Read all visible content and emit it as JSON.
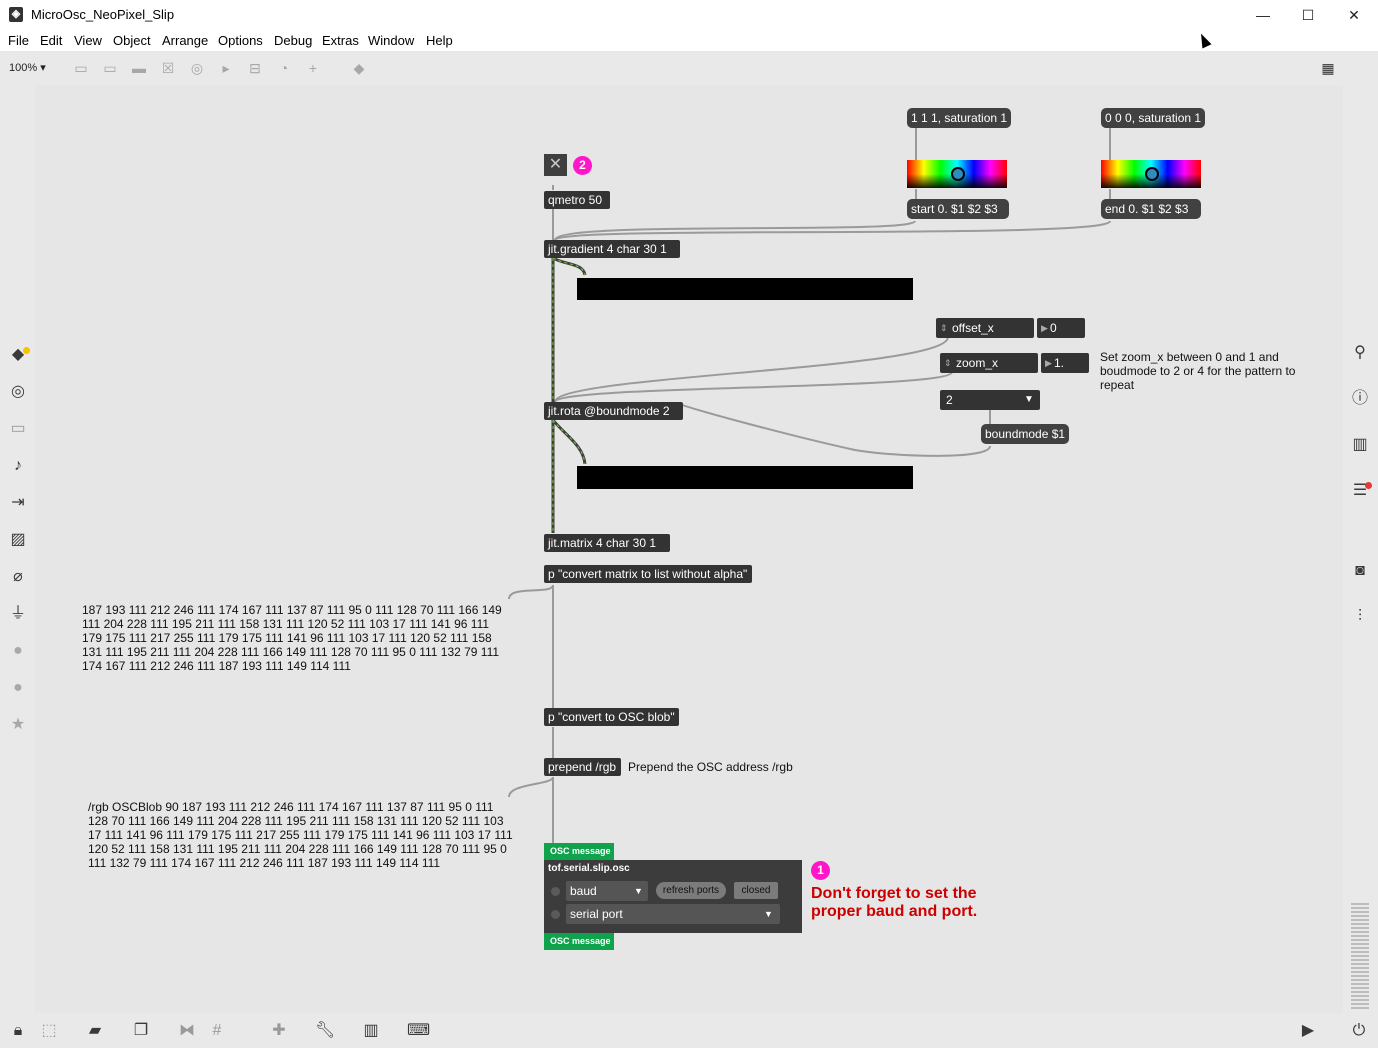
{
  "window": {
    "title": "MicroOsc_NeoPixel_Slip",
    "minimize": "—",
    "maximize": "☐",
    "close": "✕"
  },
  "menu": [
    "File",
    "Edit",
    "View",
    "Object",
    "Arrange",
    "Options",
    "Debug",
    "Extras",
    "Window",
    "Help"
  ],
  "toolbar": {
    "zoom": "100%",
    "zoom_arrow": "▾"
  },
  "patch": {
    "toggle_glyph": "✕",
    "badge_2": "2",
    "badge_1": "1",
    "qmetro": "qmetro 50",
    "msg_start_color": "1 1 1, saturation 1",
    "msg_end_color": "0 0 0, saturation 1",
    "msg_start": "start 0. $1 $2 $3",
    "msg_end": "end 0. $1 $2 $3",
    "jit_gradient": "jit.gradient 4 char 30 1",
    "offset_x_label": "offset_x",
    "offset_x_value": "0",
    "zoom_x_label": "zoom_x",
    "zoom_x_value": "1.",
    "zoom_comment": "Set zoom_x between 0 and 1 and\nboudmode to 2 or 4 for the pattern to\nrepeat",
    "boundmode_menu": "2",
    "boundmode_msg": "boundmode $1",
    "jit_rota": "jit.rota @boundmode 2",
    "jit_matrix": "jit.matrix 4 char 30 1",
    "p_convert_list": "p \"convert matrix to list without alpha\"",
    "list_output": "187 193 111 212 246 111 174 167 111 137 87 111 95 0 111 128 70 111 166 149\n111 204 228 111 195 211 111 158 131 111 120 52 111 103 17 111 141 96 111\n179 175 111 217 255 111 179 175 111 141 96 111 103 17 111 120 52 111 158\n131 111 195 211 111 204 228 111 166 149 111 128 70 111 95 0 111 132 79 111\n174 167 111 212 246 111 187 193 111 149 114 111",
    "p_convert_osc": "p \"convert to OSC blob\"",
    "prepend": "prepend /rgb",
    "prepend_comment": "Prepend the OSC address /rgb",
    "osc_output": "/rgb OSCBlob 90 187 193 111 212 246 111 174 167 111 137 87 111 95 0 111\n128 70 111 166 149 111 204 228 111 195 211 111 158 131 111 120 52 111 103\n17 111 141 96 111 179 175 111 217 255 111 179 175 111 141 96 111 103 17 111\n120 52 111 158 131 111 195 211 111 204 228 111 166 149 111 128 70 111 95 0\n111 132 79 111 174 167 111 212 246 111 187 193 111 149 114 111",
    "osc_message_top": "OSC message",
    "osc_message_bottom": "OSC message",
    "serial_title": "tof.serial.slip.osc",
    "baud_label": "baud",
    "refresh_ports": "refresh ports",
    "closed": "closed",
    "serial_port_label": "serial port",
    "reminder": "Don't forget to set the\nproper baud and port."
  },
  "colors": {
    "accent_badge": "#ff16c8",
    "osc_green": "#0ea34c",
    "reminder_red": "#cc0000",
    "patch_bg": "#e6e6e6"
  },
  "icons": {
    "left_sidebar": [
      "packages-icon",
      "target-icon",
      "keyboard-icon",
      "music-note-icon",
      "step-icon",
      "image-icon",
      "paperclip-icon",
      "plug-icon",
      "vst-icon",
      "beat-icon",
      "star-icon"
    ],
    "right_sidebar": [
      "search-icon",
      "info-icon",
      "book-icon",
      "list-icon",
      "camera-icon",
      "sliders-icon"
    ],
    "bottom": [
      "lock-icon",
      "edit-icon",
      "presentation-icon",
      "windows-icon",
      "debug-icon",
      "grid-icon",
      "add-icon",
      "wrench-icon",
      "piano-icon",
      "keypad-icon",
      "play-icon",
      "power-icon"
    ]
  }
}
